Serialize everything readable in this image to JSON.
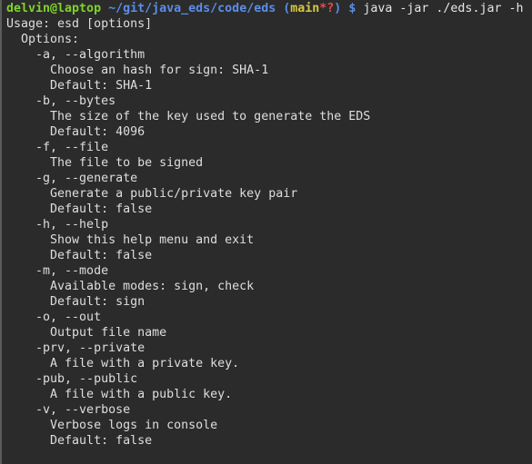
{
  "prompt": {
    "user_host": "delvin@laptop",
    "path": "~/git/java_eds/code/eds",
    "paren_open": "(",
    "branch": "main",
    "dirty_marker": "*?",
    "paren_close": ")",
    "dollar": "$",
    "command": "java -jar ./eds.jar -h"
  },
  "output_lines": [
    "Usage: esd [options]",
    "  Options:",
    "    -a, --algorithm",
    "      Choose an hash for sign: SHA-1",
    "      Default: SHA-1",
    "    -b, --bytes",
    "      The size of the key used to generate the EDS",
    "      Default: 4096",
    "    -f, --file",
    "      The file to be signed",
    "    -g, --generate",
    "      Generate a public/private key pair",
    "      Default: false",
    "    -h, --help",
    "      Show this help menu and exit",
    "      Default: false",
    "    -m, --mode",
    "      Available modes: sign, check",
    "      Default: sign",
    "    -o, --out",
    "      Output file name",
    "    -prv, --private",
    "      A file with a private key.",
    "    -pub, --public",
    "      A file with a public key.",
    "    -v, --verbose",
    "      Verbose logs in console",
    "      Default: false"
  ],
  "colors": {
    "background": "#2b2b2b",
    "user_host": "#7fd32a",
    "path": "#5b8de8",
    "branch": "#d7c93f",
    "dirty_marker": "#e44b4b",
    "text": "#dedede"
  }
}
